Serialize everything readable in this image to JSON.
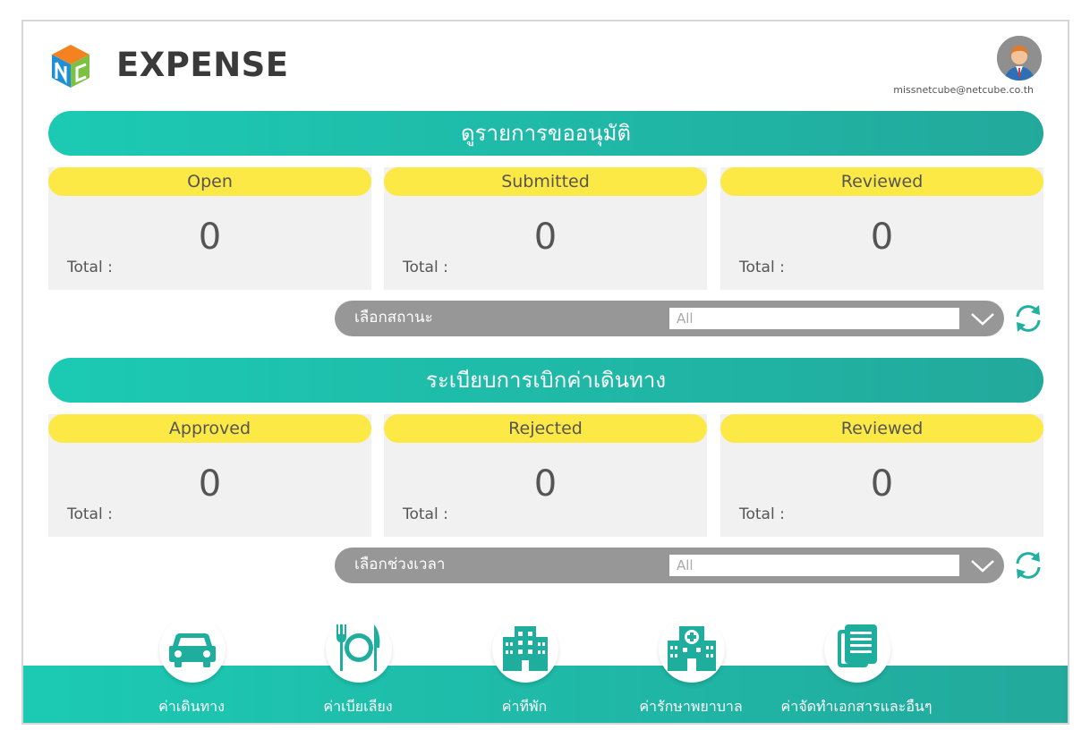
{
  "app": {
    "title": "EXPENSE"
  },
  "user": {
    "email": "missnetcube@netcube.co.th"
  },
  "approval_section": {
    "title": "ดูรายการขออนุมัติ",
    "cards": [
      {
        "label": "Open",
        "value": "0",
        "total_label": "Total :"
      },
      {
        "label": "Submitted",
        "value": "0",
        "total_label": "Total :"
      },
      {
        "label": "Reviewed",
        "value": "0",
        "total_label": "Total :"
      }
    ],
    "filter": {
      "label": "เลือกสถานะ",
      "value": "All"
    }
  },
  "travel_section": {
    "title": "ระเบียบการเบิกค่าเดินทาง",
    "cards": [
      {
        "label": "Approved",
        "value": "0",
        "total_label": "Total :"
      },
      {
        "label": "Rejected",
        "value": "0",
        "total_label": "Total :"
      },
      {
        "label": "Reviewed",
        "value": "0",
        "total_label": "Total :"
      }
    ],
    "filter": {
      "label": "เลือกช่วงเวลา",
      "value": "All"
    }
  },
  "nav": [
    {
      "label": "ค่าเดินทาง",
      "icon": "car-icon"
    },
    {
      "label": "ค่าเบียเลียง",
      "icon": "meal-icon"
    },
    {
      "label": "ค่าทีพัก",
      "icon": "hotel-icon"
    },
    {
      "label": "ค่ารักษาพยาบาล",
      "icon": "hospital-icon"
    },
    {
      "label": "ค่าจัดทำเอกสารและอืนๆ",
      "icon": "document-icon"
    }
  ],
  "colors": {
    "teal": "#1ccab3",
    "teal_dark": "#22a99c",
    "yellow": "#fde945",
    "card_bg": "#f1f1f1",
    "filter_gray": "#979797"
  }
}
